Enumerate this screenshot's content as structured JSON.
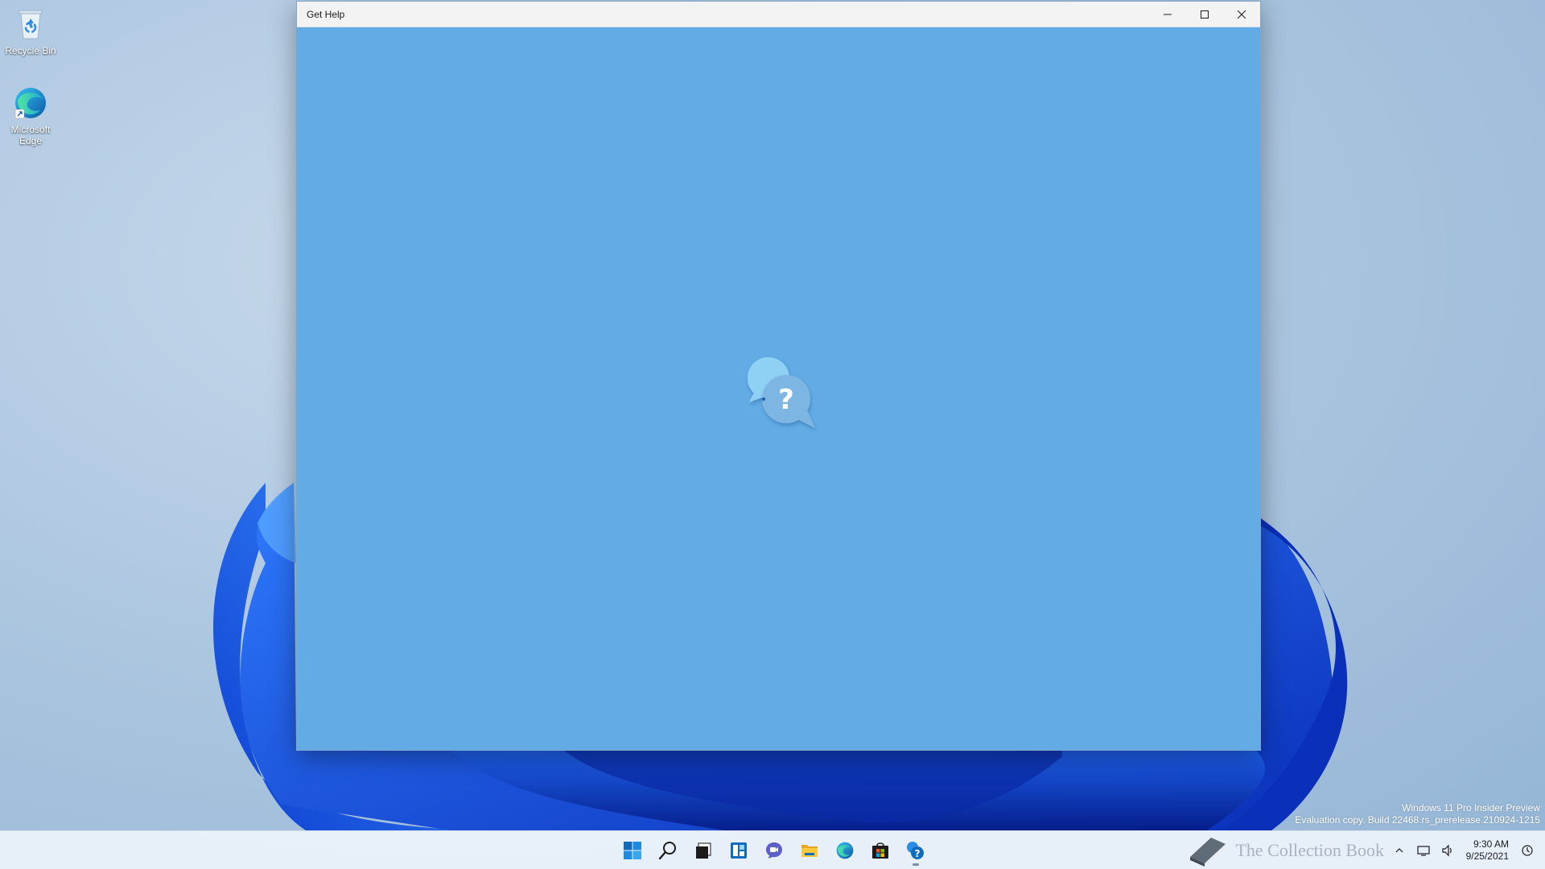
{
  "desktop": {
    "icons": [
      {
        "label": "Recycle Bin",
        "icon": "recycle-bin-icon"
      },
      {
        "label": "Microsoft Edge",
        "icon": "edge-icon"
      }
    ]
  },
  "window": {
    "title": "Get Help",
    "controls": {
      "minimize": "minimize-icon",
      "maximize": "maximize-icon",
      "close": "close-icon"
    },
    "background_color": "#62abe4",
    "splash_icon": "get-help-icon"
  },
  "watermark": {
    "line1": "Windows 11 Pro Insider Preview",
    "line2": "Evaluation copy. Build 22468.rs_prerelease.210924-1215"
  },
  "taskbar": {
    "apps": [
      {
        "name": "Start",
        "icon": "windows-start-icon"
      },
      {
        "name": "Search",
        "icon": "search-icon"
      },
      {
        "name": "Task View",
        "icon": "task-view-icon"
      },
      {
        "name": "Widgets",
        "icon": "widgets-icon"
      },
      {
        "name": "Chat",
        "icon": "chat-icon"
      },
      {
        "name": "File Explorer",
        "icon": "file-explorer-icon"
      },
      {
        "name": "Microsoft Edge",
        "icon": "edge-icon"
      },
      {
        "name": "Microsoft Store",
        "icon": "store-icon"
      },
      {
        "name": "Get Help",
        "icon": "get-help-icon"
      }
    ],
    "tray": {
      "logo_text": "The Collection Book",
      "time": "9:30 AM",
      "date": "9/25/2021"
    }
  }
}
